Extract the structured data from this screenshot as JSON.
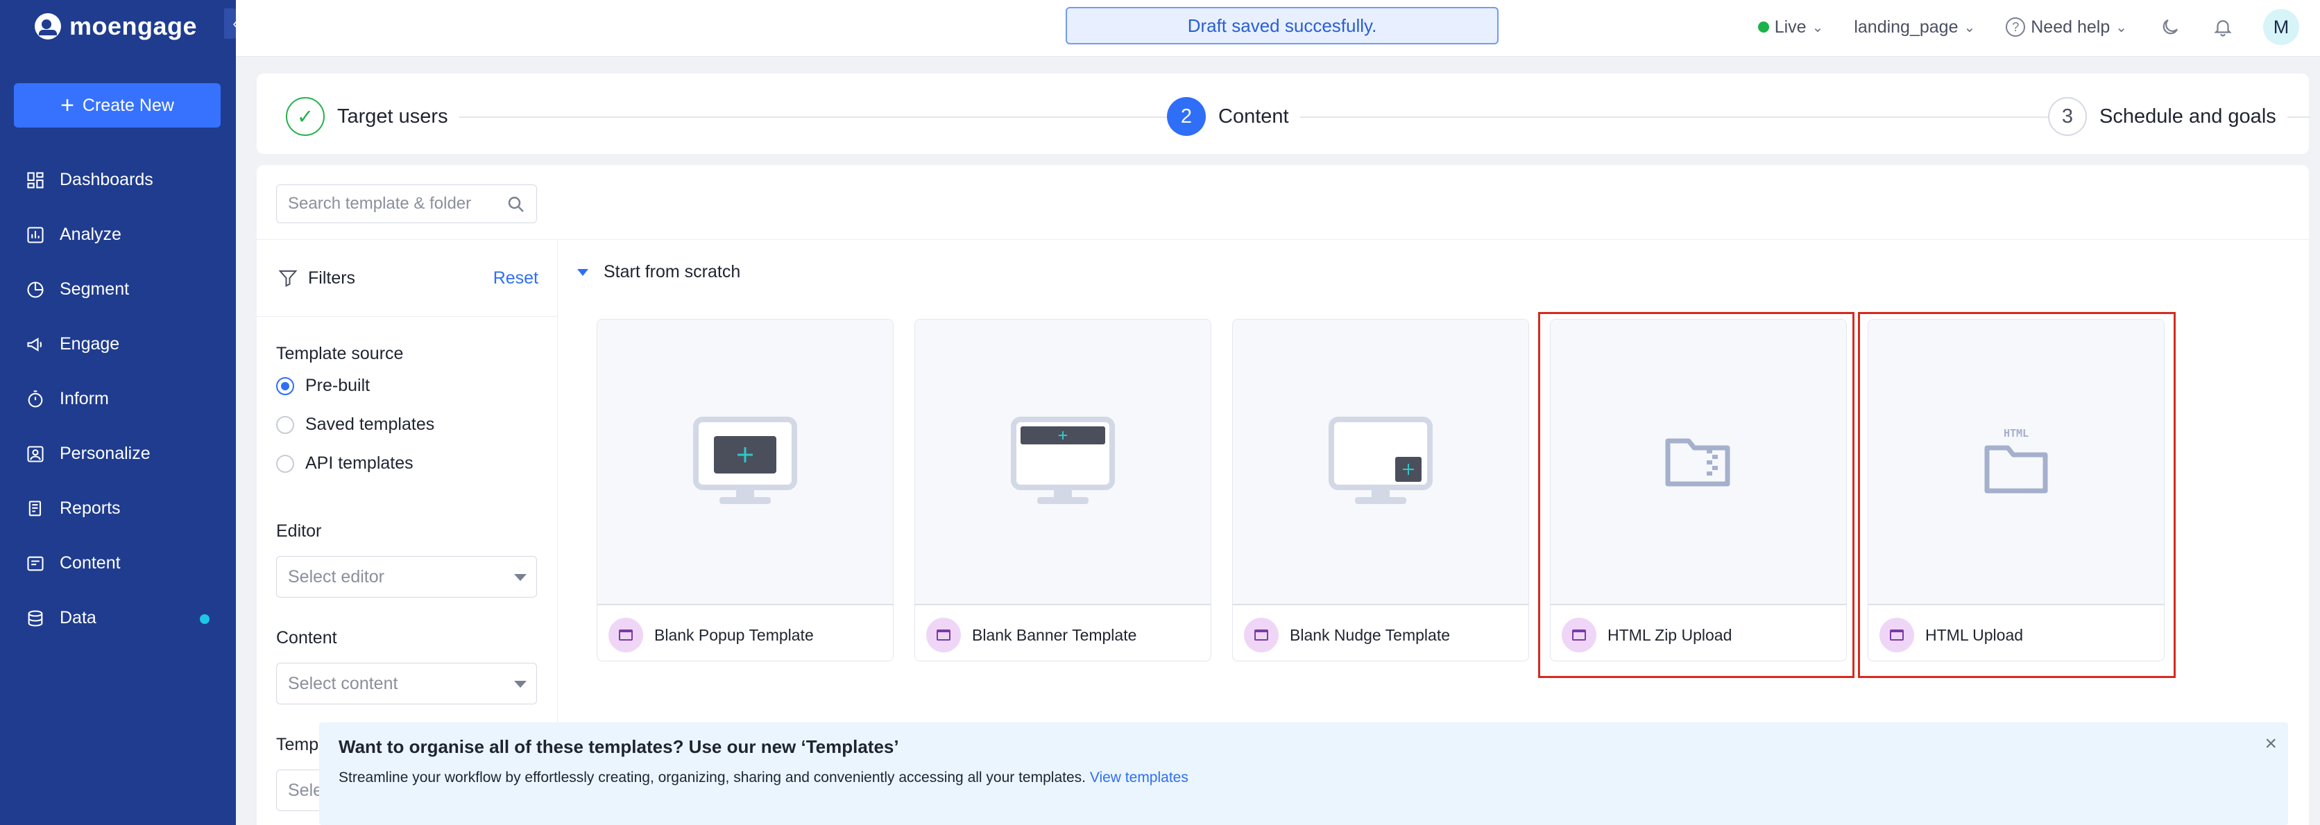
{
  "brand": {
    "name": "moengage"
  },
  "sidebar": {
    "create_label": "Create New",
    "items": [
      {
        "label": "Dashboards",
        "icon": "dashboard-icon"
      },
      {
        "label": "Analyze",
        "icon": "bar-chart-icon"
      },
      {
        "label": "Segment",
        "icon": "pie-chart-icon"
      },
      {
        "label": "Engage",
        "icon": "megaphone-icon"
      },
      {
        "label": "Inform",
        "icon": "stopwatch-icon"
      },
      {
        "label": "Personalize",
        "icon": "person-board-icon"
      },
      {
        "label": "Reports",
        "icon": "document-icon"
      },
      {
        "label": "Content",
        "icon": "content-icon"
      },
      {
        "label": "Data",
        "icon": "database-icon"
      }
    ],
    "accent_dot_color": "#1ec7e6"
  },
  "topbar": {
    "toast": "Draft saved succesfully.",
    "env": "Live",
    "workspace": "landing_page",
    "help": "Need help",
    "avatar": "M"
  },
  "stepper": {
    "steps": [
      {
        "num": "✓",
        "label": "Target users",
        "state": "done"
      },
      {
        "num": "2",
        "label": "Content",
        "state": "active"
      },
      {
        "num": "3",
        "label": "Schedule and goals",
        "state": "pending"
      }
    ]
  },
  "search": {
    "placeholder": "Search template & folder"
  },
  "filters": {
    "title": "Filters",
    "reset": "Reset",
    "template_source": {
      "label": "Template source",
      "options": [
        "Pre-built",
        "Saved templates",
        "API templates"
      ],
      "selected": "Pre-built"
    },
    "editor": {
      "label": "Editor",
      "placeholder": "Select editor"
    },
    "content": {
      "label": "Content",
      "placeholder": "Select content"
    },
    "template_type": {
      "label": "Template type",
      "placeholder": "Select template type"
    }
  },
  "section": {
    "title": "Start from scratch"
  },
  "templates": [
    {
      "name": "Blank Popup Template",
      "icon": "popup-monitor-icon",
      "highlighted": false
    },
    {
      "name": "Blank Banner Template",
      "icon": "banner-monitor-icon",
      "highlighted": false
    },
    {
      "name": "Blank Nudge Template",
      "icon": "nudge-monitor-icon",
      "highlighted": false
    },
    {
      "name": "HTML Zip Upload",
      "icon": "zip-folder-icon",
      "highlighted": true
    },
    {
      "name": "HTML Upload",
      "icon": "html-folder-icon",
      "highlighted": true
    }
  ],
  "banner": {
    "title": "Want to organise all of these templates? Use our new ‘Templates’",
    "text": "Streamline your workflow by effortlessly creating, organizing, sharing and conveniently accessing all your templates.",
    "link": "View templates"
  },
  "colors": {
    "sidebar_bg": "#1f3c8f",
    "primary": "#2f6ef7",
    "success": "#25b24a",
    "highlight": "#d62b1f"
  }
}
